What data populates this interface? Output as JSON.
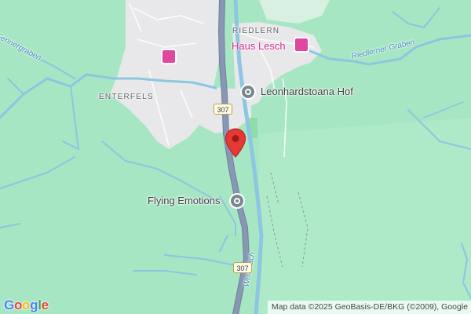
{
  "map": {
    "colors": {
      "forest": "#a7e6c2",
      "settlement": "#e8e8ea",
      "water": "#8cc6e2",
      "highway": "#8898b4",
      "marker": "#e53935",
      "hotel": "#d52c8e"
    }
  },
  "places": {
    "riedlern": "RIEDLERN",
    "enterfels": "ENTERFELS"
  },
  "pois": {
    "haus_lesch": "Haus Lesch",
    "leonhardstoana_hof": "Leonhardstoana Hof",
    "flying_emotions": "Flying Emotions"
  },
  "waterways": {
    "fennergraben": "Fennergraben",
    "riedlerner_graben": "Riedlerner Graben",
    "weissbach": "Weißbach"
  },
  "roads": {
    "shield_top": "307",
    "shield_bottom": "307"
  },
  "icons": {
    "hotel": "hotel-icon",
    "poi": "place-icon",
    "marker": "map-pin-icon"
  },
  "branding": {
    "logo_g": "G",
    "logo_o1": "o",
    "logo_o2": "o",
    "logo_g2": "g",
    "logo_l": "l",
    "logo_e": "e"
  },
  "attribution": "Map data ©2025 GeoBasis-DE/BKG (©2009), Google"
}
